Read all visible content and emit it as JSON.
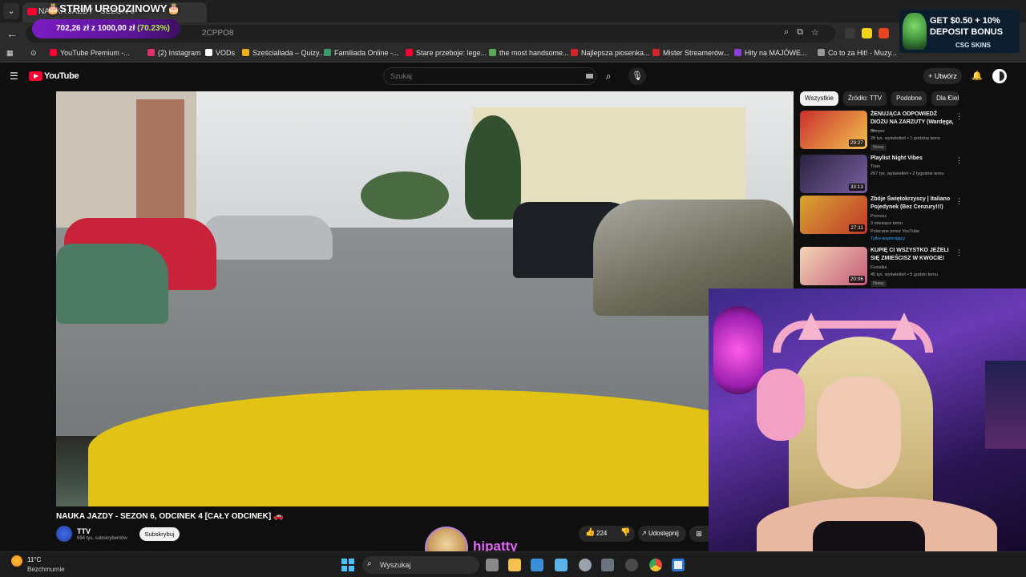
{
  "browser": {
    "tab_title": "NAUKA JAZDY - SEZON 6",
    "url_fragment": "2CPPO8",
    "bookmarks": [
      {
        "label": "YouTube Premium -...",
        "color": "#ff0033"
      },
      {
        "label": "(2) Instagram",
        "color": "#e1306c"
      },
      {
        "label": "VODs",
        "color": "#ffffff"
      },
      {
        "label": "Sześcialiada – Quizy...",
        "color": "#f2b01e"
      },
      {
        "label": "Familiada Online -...",
        "color": "#3a9a6a"
      },
      {
        "label": "Stare przeboje: lege...",
        "color": "#ff0033"
      },
      {
        "label": "the most handsome...",
        "color": "#5aa84f"
      },
      {
        "label": "Najlepsza piosenka...",
        "color": "#d4232b"
      },
      {
        "label": "Mister Streamerów...",
        "color": "#d4232b"
      },
      {
        "label": "Hity na MAJÓWE...",
        "color": "#8b3fd6"
      },
      {
        "label": "Co to za Hit! - Muzy...",
        "color": "#999999"
      }
    ]
  },
  "overlay": {
    "stream_title": "STRIM URODZINOWY",
    "donation": {
      "amount": "702,26 zł",
      "separator": " z ",
      "goal": "1000,00 zł",
      "percent": "(70.23%)",
      "fraction": 0.7023
    },
    "ad": {
      "line1": "GET $0.50 + 10%",
      "line2": "DEPOSIT BONUS",
      "line3": "CSG SKINS"
    },
    "streamer_name": "hipatty"
  },
  "youtube": {
    "logo_text": "YouTube",
    "search_placeholder": "Szukaj",
    "create_label": "Utwórz",
    "video_title": "NAUKA JAZDY - SEZON 6, ODCINEK 4 [CAŁY ODCINEK] 🚗",
    "channel": {
      "name": "TTV",
      "subscribers": "694 tys. subskrybentów"
    },
    "subscribe_label": "Subskrybuj",
    "likes": "224",
    "share_label": "Udostępnij",
    "chips": [
      "Wszystkie",
      "Źródło: TTV",
      "Podobne",
      "Dla Ciebie"
    ],
    "recommendations": [
      {
        "title": "ŻENUJĄCA ODPOWIEDŹ DIOZU NA ZARZUTY (Wardęga, ...",
        "channel": "Gimper",
        "meta": "28 tys. wyświetleń • 1 godzinę temu",
        "badge": "Nowy",
        "duration": "29:27",
        "thumb": "#c9302c"
      },
      {
        "title": "Playlist Night Vibes",
        "channel": "Titan",
        "meta": "267 tys. wyświetleń • 2 tygodnie temu",
        "badge": "",
        "duration": "33:13",
        "thumb": "#4a3a6a"
      },
      {
        "title": "Zbóje Świętokrzyscy | Italiano Pojedynek (Bez Cenzury!!!)",
        "channel": "Pronosz",
        "meta": "3 miesiące temu",
        "extra": "Polecane przez YouTube",
        "green": "Tylko wspierający",
        "duration": "27:11",
        "thumb": "#d9a531"
      },
      {
        "title": "KUPIĘ CI WSZYSTKO JEŻELI SIĘ ZMIEŚCISZ W KWOCIE!",
        "channel": "Fusialka",
        "meta": "45 tys. wyświetleń • 5 godzin temu",
        "badge": "Nowy",
        "duration": "20:06",
        "thumb": "#c45a7a"
      }
    ]
  },
  "taskbar": {
    "temperature": "11°C",
    "weather": "Bezchmurnie",
    "search_label": "Wyszukaj"
  }
}
